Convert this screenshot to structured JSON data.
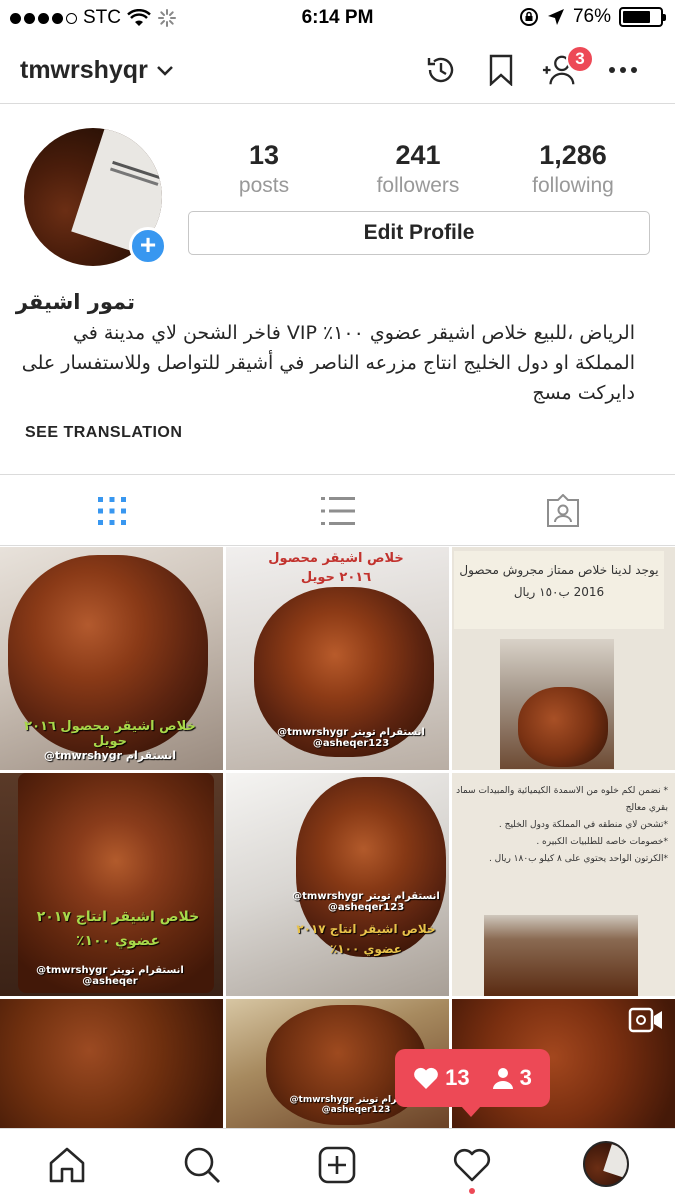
{
  "status_bar": {
    "carrier": "STC",
    "time": "6:14 PM",
    "battery": "76%",
    "battery_level": 0.76
  },
  "header": {
    "username": "tmwrshyqr",
    "icons": [
      "activity-archive-icon",
      "bookmark-icon",
      "discover-people-icon",
      "more-icon"
    ],
    "people_badge": "3"
  },
  "profile": {
    "stats": [
      {
        "value": "13",
        "label": "posts"
      },
      {
        "value": "241",
        "label": "followers"
      },
      {
        "value": "1,286",
        "label": "following"
      }
    ],
    "edit_label": "Edit Profile",
    "name": "تمور اشيقر",
    "bio": "الرياض ،للبيع خلاص اشيقر عضوي ١٠٠٪ VIP فاخر الشحن لاي مدينة في المملكة او دول الخليج انتاج مزرعه الناصر في أشيقر للتواصل وللاستفسار على دايركت مسج",
    "see_translation": "SEE TRANSLATION"
  },
  "tabs": [
    "grid-view-icon",
    "list-view-icon",
    "tagged-icon"
  ],
  "grid": {
    "post1": {
      "text": "خلاص اشيقر محصول ٢٠١٦ حويل",
      "watermark": "@tmwrshygr انستقرام"
    },
    "post2": {
      "text": "خلاص اشيقر محصول ٢٠١٦ حويل",
      "watermark": "@tmwrshygr انستقرام تويتر @asheqer123"
    },
    "post3": {
      "text": "يوجد لدينا خلاص ممتاز مجروش محصول 2016 ب١٥٠ ريال"
    },
    "post4": {
      "text": "خلاص اشيقر انتاج ٢٠١٧ عضوي ١٠٠٪",
      "watermark": "@tmwrshygr انستقرام تويتر @asheqer"
    },
    "post5": {
      "text": "خلاص اشيقر انتاج ٢٠١٧ عضوي ١٠٠٪",
      "watermark": "@tmwrshygr انستقرام تويتر @asheqer123"
    },
    "post6": {
      "lines": [
        "* نضمن لكم خلوه من الاسمدة الكيميائية والمبيدات سماد بقري معالج",
        "*تشحن لاي منطقه في المملكة ودول الخليج .",
        "*خصومات خاصه للطلبيات الكبيره .",
        "*الكرتون الواحد يحتوي على ٨ كيلو ب١٨٠ ريال ."
      ]
    },
    "post8": {
      "watermark": "@tmwrshygr انستقرام تويتر @asheqer123"
    }
  },
  "activity_tooltip": {
    "likes": "13",
    "follows": "3"
  },
  "bottom_nav": [
    "home-icon",
    "search-icon",
    "new-post-icon",
    "activity-heart-icon",
    "profile-avatar"
  ],
  "colors": {
    "accent": "#3897f0",
    "notification": "#ed4956",
    "border": "#dbdbdb"
  }
}
